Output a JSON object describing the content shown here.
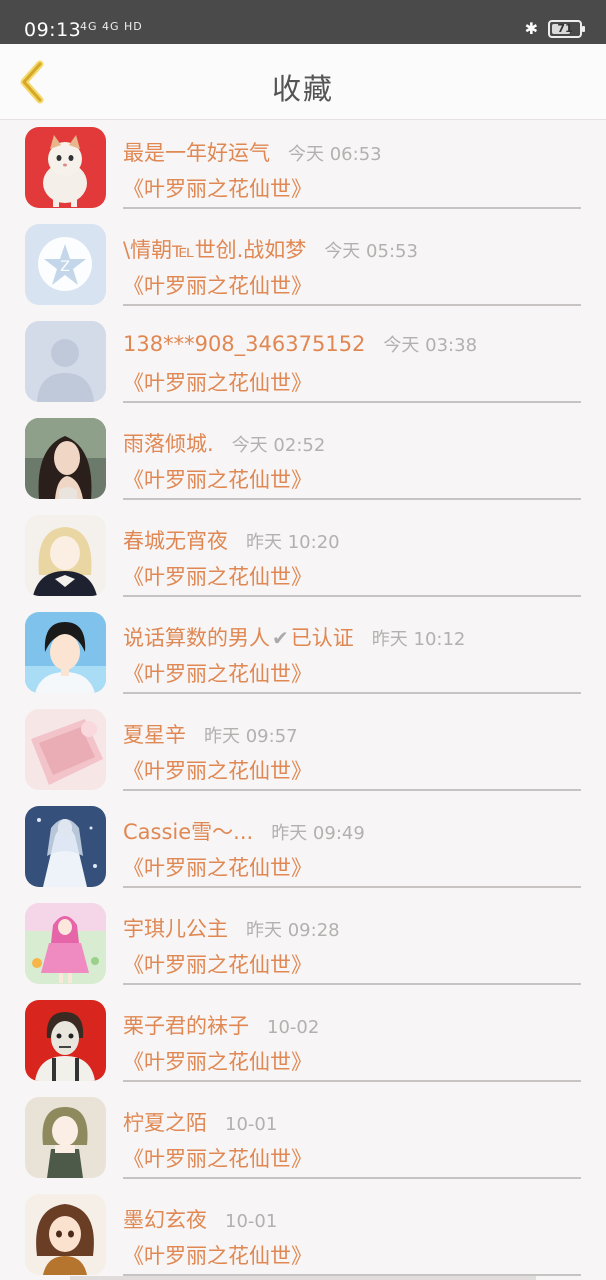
{
  "status_bar": {
    "time": "09:13",
    "signals": "4G 4G HD",
    "battery": "71",
    "battery_fraction": 0.71
  },
  "header": {
    "title": "收藏"
  },
  "items": [
    {
      "name": "最是一年好运气",
      "time": "今天 06:53",
      "subtitle": "《叶罗丽之花仙世》",
      "avatar": "kitten"
    },
    {
      "name": "\\情朝℡世创.战如梦",
      "time": "今天 05:53",
      "subtitle": "《叶罗丽之花仙世》",
      "avatar": "default-star"
    },
    {
      "name": "138***908_346375152",
      "time": "今天 03:38",
      "subtitle": "《叶罗丽之花仙世》",
      "avatar": "default-silhouette"
    },
    {
      "name": "雨落倾城.",
      "time": "今天 02:52",
      "subtitle": "《叶罗丽之花仙世》",
      "avatar": "photo-woman"
    },
    {
      "name": "春城无宵夜",
      "time": "昨天 10:20",
      "subtitle": "《叶罗丽之花仙世》",
      "avatar": "anime-blonde"
    },
    {
      "name": "说话算数的男人",
      "verified": "已认证",
      "time": "昨天 10:12",
      "subtitle": "《叶罗丽之花仙世》",
      "avatar": "anime-boy"
    },
    {
      "name": "夏星辛",
      "time": "昨天 09:57",
      "subtitle": "《叶罗丽之花仙世》",
      "avatar": "pink-fabric"
    },
    {
      "name": "Cassie雪～...",
      "time": "昨天 09:49",
      "subtitle": "《叶罗丽之花仙世》",
      "avatar": "white-gown"
    },
    {
      "name": "宇琪儿公主",
      "time": "昨天 09:28",
      "subtitle": "《叶罗丽之花仙世》",
      "avatar": "pink-doll"
    },
    {
      "name": "栗子君的袜子",
      "time": "10-02",
      "subtitle": "《叶罗丽之花仙世》",
      "avatar": "red-zombie"
    },
    {
      "name": "柠夏之陌",
      "time": "10-01",
      "subtitle": "《叶罗丽之花仙世》",
      "avatar": "anime-girl-green"
    },
    {
      "name": "墨幻玄夜",
      "time": "10-01",
      "subtitle": "《叶罗丽之花仙世》",
      "avatar": "anime-brown-hair"
    }
  ],
  "colors": {
    "accent": "#e08853",
    "time_gray": "#b3b0b0",
    "status_bar": "#4a4a4a",
    "back_arrow": "#e3bf3e"
  }
}
